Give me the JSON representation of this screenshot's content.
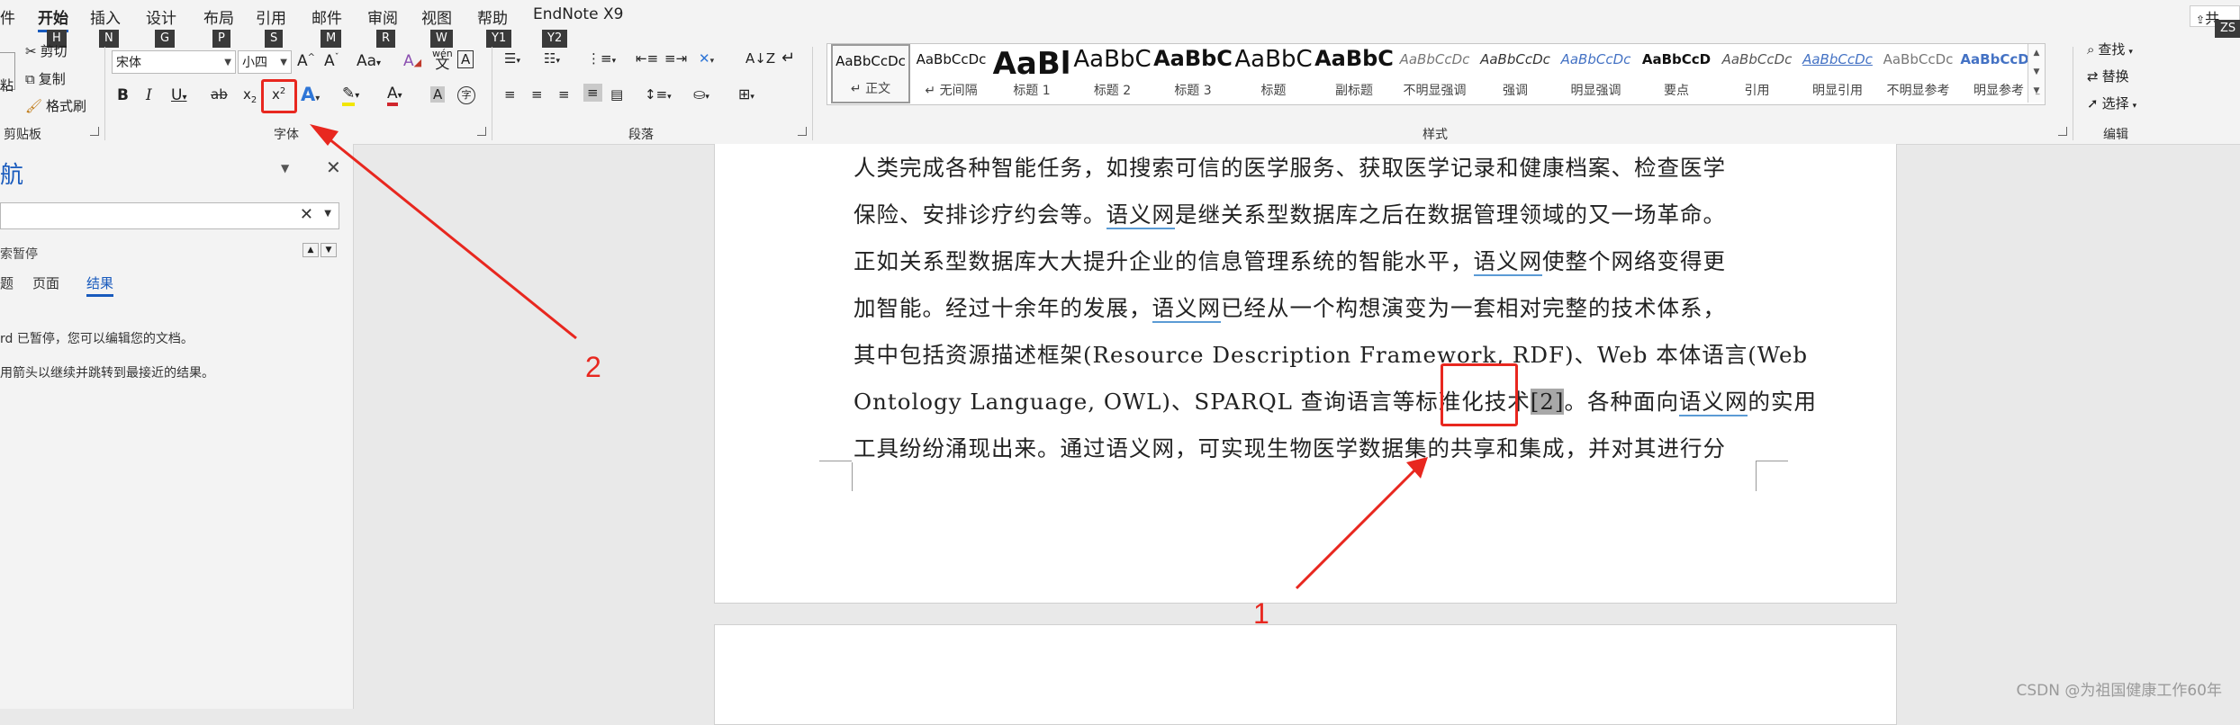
{
  "ribbon": {
    "tabs": [
      {
        "label": "件",
        "key": ""
      },
      {
        "label": "开始",
        "key": "H",
        "active": true
      },
      {
        "label": "插入",
        "key": "N"
      },
      {
        "label": "设计",
        "key": "G"
      },
      {
        "label": "布局",
        "key": "P"
      },
      {
        "label": "引用",
        "key": "S"
      },
      {
        "label": "邮件",
        "key": "M"
      },
      {
        "label": "审阅",
        "key": "R"
      },
      {
        "label": "视图",
        "key": "W"
      },
      {
        "label": "帮助",
        "key": "Y1"
      },
      {
        "label": "EndNote X9",
        "key": "Y2"
      }
    ],
    "right_corner": "共",
    "right_key": "ZS",
    "clipboard": {
      "cut": "剪切",
      "copy": "复制",
      "format_painter": "格式刷",
      "paste": "粘",
      "label": "剪贴板"
    },
    "font": {
      "name": "宋体",
      "size": "小四",
      "label": "字体",
      "grow": "A^",
      "shrink": "A˅",
      "case": "Aa",
      "clear": "A",
      "pinyin": "wén",
      "border_char": "A",
      "bold": "B",
      "italic": "I",
      "underline": "U",
      "strike": "ab",
      "subscript": "x₂",
      "superscript": "x²",
      "effects": "A",
      "highlight": "✎",
      "color": "A",
      "shade": "A",
      "enclose": "字"
    },
    "paragraph": {
      "label": "段落"
    },
    "styles": {
      "label": "样式",
      "items": [
        {
          "sample": "AaBbCcDc",
          "name": "↵ 正文",
          "selected": true,
          "size": 15,
          "weight": "normal",
          "color": "#111"
        },
        {
          "sample": "AaBbCcDc",
          "name": "↵ 无间隔",
          "size": 15,
          "weight": "normal",
          "color": "#111"
        },
        {
          "sample": "AaBl",
          "name": "标题 1",
          "size": 34,
          "weight": "bold",
          "color": "#111"
        },
        {
          "sample": "AaBbC",
          "name": "标题 2",
          "size": 26,
          "weight": "normal",
          "color": "#111"
        },
        {
          "sample": "AaBbC",
          "name": "标题 3",
          "size": 24,
          "weight": "bold",
          "color": "#111"
        },
        {
          "sample": "AaBbC",
          "name": "标题",
          "size": 26,
          "weight": "normal",
          "color": "#111"
        },
        {
          "sample": "AaBbC",
          "name": "副标题",
          "size": 24,
          "weight": "bold",
          "color": "#111"
        },
        {
          "sample": "AaBbCcDc",
          "name": "不明显强调",
          "size": 15,
          "weight": "normal",
          "color": "#777",
          "italic": true
        },
        {
          "sample": "AaBbCcDc",
          "name": "强调",
          "size": 15,
          "weight": "normal",
          "color": "#333",
          "italic": true
        },
        {
          "sample": "AaBbCcDc",
          "name": "明显强调",
          "size": 15,
          "weight": "normal",
          "color": "#4472c4",
          "italic": true
        },
        {
          "sample": "AaBbCcD",
          "name": "要点",
          "size": 15,
          "weight": "bold",
          "color": "#111"
        },
        {
          "sample": "AaBbCcDc",
          "name": "引用",
          "size": 15,
          "weight": "normal",
          "color": "#555",
          "italic": true
        },
        {
          "sample": "AaBbCcDc",
          "name": "明显引用",
          "size": 15,
          "weight": "normal",
          "color": "#4472c4",
          "italic": true,
          "underline": true
        },
        {
          "sample": "AaBbCcDc",
          "name": "不明显参考",
          "size": 15,
          "weight": "normal",
          "color": "#777"
        },
        {
          "sample": "AaBbCcDc",
          "name": "明显参考",
          "size": 15,
          "weight": "bold",
          "color": "#4472c4"
        }
      ]
    },
    "editing": {
      "find": "查找",
      "replace": "替换",
      "select": "选择",
      "label": "编辑"
    }
  },
  "nav": {
    "title": "航",
    "search_value": "",
    "paused": "索暂停",
    "tabs": [
      "题",
      "页面",
      "结果"
    ],
    "msg1": "rd 已暂停，您可以编辑您的文档。",
    "msg2": "用箭头以继续并跳转到最接近的结果。"
  },
  "doc": {
    "lines": [
      [
        "人类完成各种智能任务，如搜索可信的医学服务、获取医学记录和健康档案、检查医学"
      ],
      [
        "保险、安排诊疗约会等。",
        {
          "u": "语义网"
        },
        "是继关系型数据库之后在数据管理领域的又一场革命。"
      ],
      [
        "正如关系型数据库大大提升企业的信息管理系统的智能水平，",
        {
          "u": "语义网"
        },
        "使整个网络变得更"
      ],
      [
        "加智能。经过十余年的发展，",
        {
          "u": "语义网"
        },
        "已经从一个构想演变为一套相对完整的技术体系，"
      ],
      [
        "其中包括资源描述框架(Resource Description Framework, RDF)、Web 本体语言(Web"
      ],
      [
        "Ontology Language, OWL)、SPARQL 查询语言等标准化技术",
        {
          "h": "[2]"
        },
        "。各种面向",
        {
          "u": "语义网"
        },
        "的实用"
      ],
      [
        "工具纷纷涌现出来。通过语义网，可实现生物医学数据集的共享和集成，并对其进行分"
      ]
    ]
  },
  "annotations": {
    "one": "1",
    "two": "2"
  },
  "watermark": "CSDN @为祖国健康工作60年",
  "colors": {
    "accent": "#185abd",
    "annotation": "#e8271f",
    "link_underline": "#5b9bd5"
  }
}
